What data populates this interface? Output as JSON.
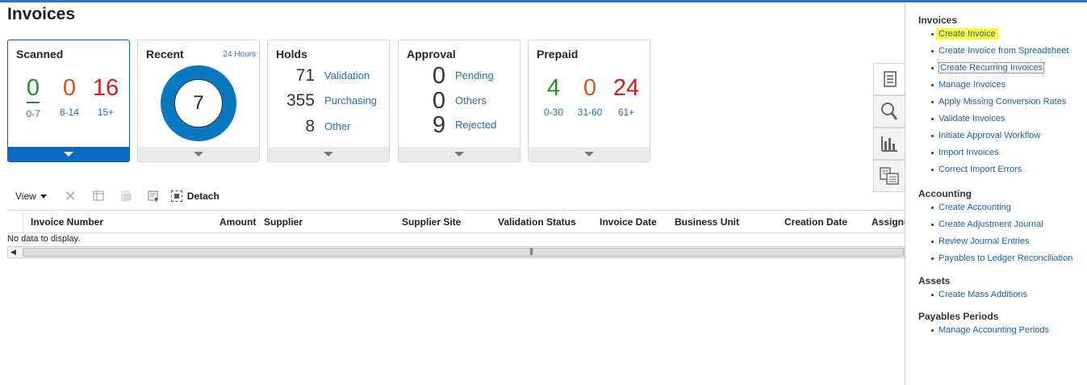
{
  "page": {
    "title": "Invoices"
  },
  "tiles": {
    "scanned": {
      "title": "Scanned",
      "buckets": [
        {
          "value": "0",
          "label": "0-7",
          "color": "#2f8a2f"
        },
        {
          "value": "0",
          "label": "8-14",
          "color": "#d1571a"
        },
        {
          "value": "16",
          "label": "15+",
          "color": "#cc1f1f"
        }
      ]
    },
    "recent": {
      "title": "Recent",
      "sub": "24 Hours",
      "value": "7"
    },
    "holds": {
      "title": "Holds",
      "rows": [
        {
          "value": "71",
          "label": "Validation"
        },
        {
          "value": "355",
          "label": "Purchasing"
        },
        {
          "value": "8",
          "label": "Other"
        }
      ]
    },
    "approval": {
      "title": "Approval",
      "rows": [
        {
          "value": "0",
          "label": "Pending"
        },
        {
          "value": "0",
          "label": "Others"
        },
        {
          "value": "9",
          "label": "Rejected"
        }
      ]
    },
    "prepaid": {
      "title": "Prepaid",
      "buckets": [
        {
          "value": "4",
          "label": "0-30",
          "color": "#2f8a2f"
        },
        {
          "value": "0",
          "label": "31-60",
          "color": "#d1571a"
        },
        {
          "value": "24",
          "label": "61+",
          "color": "#cc1f1f"
        }
      ]
    }
  },
  "toolbar": {
    "view": "View",
    "detach": "Detach"
  },
  "table": {
    "columns": [
      "Invoice Number",
      "Amount",
      "Supplier",
      "Supplier Site",
      "Validation Status",
      "Invoice Date",
      "Business Unit",
      "Creation Date",
      "Assigne"
    ],
    "empty_text": "No data to display."
  },
  "tasks": {
    "invoices": {
      "heading": "Invoices",
      "items": [
        "Create Invoice",
        "Create Invoice from Spreadsheet",
        "Create Recurring Invoices",
        "Manage Invoices",
        "Apply Missing Conversion Rates",
        "Validate Invoices",
        "Initiate Approval Workflow",
        "Import Invoices",
        "Correct Import Errors"
      ]
    },
    "accounting": {
      "heading": "Accounting",
      "items": [
        "Create Accounting",
        "Create Adjustment Journal",
        "Review Journal Entries",
        "Payables to Ledger Reconciliation"
      ]
    },
    "assets": {
      "heading": "Assets",
      "items": [
        "Create Mass Additions"
      ]
    },
    "payables_periods": {
      "heading": "Payables Periods",
      "items": [
        "Manage Accounting Periods"
      ]
    }
  },
  "colors": {
    "accent": "#0a69c4",
    "link": "#2a6db0",
    "highlight": "#ffff33"
  }
}
